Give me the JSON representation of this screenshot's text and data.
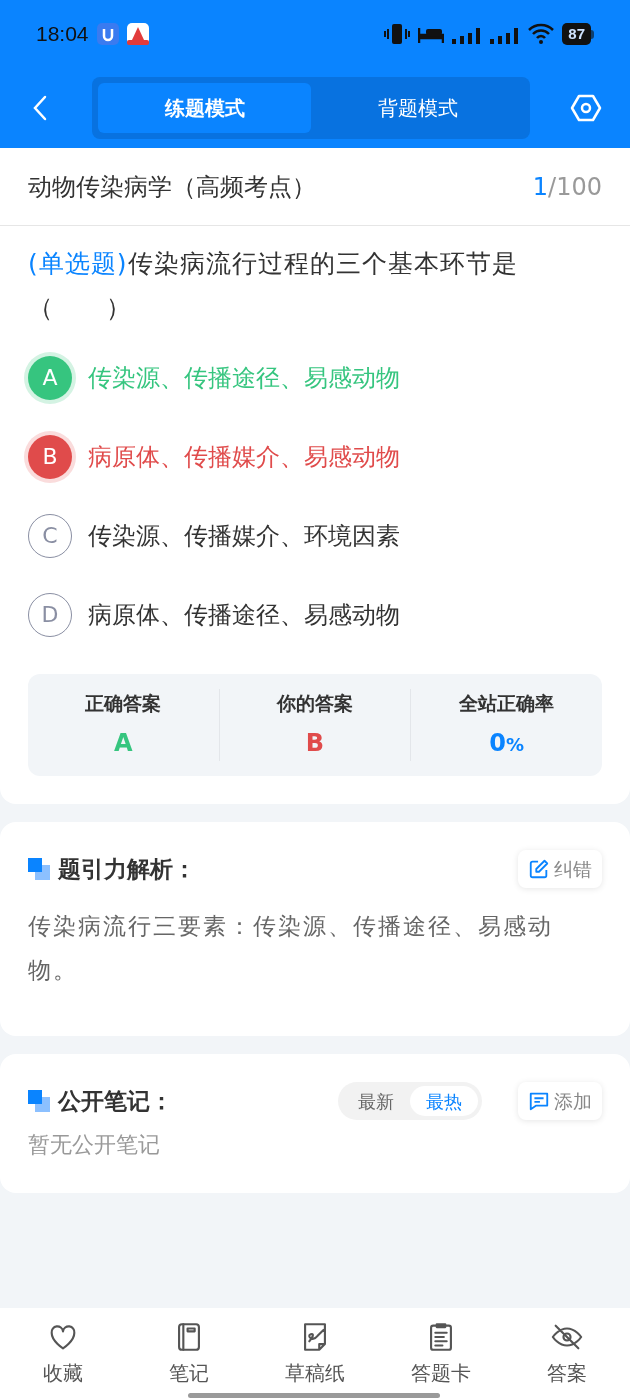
{
  "status_bar": {
    "time": "18:04",
    "battery": "87"
  },
  "header": {
    "tabs": [
      {
        "label": "练题模式",
        "selected": true
      },
      {
        "label": "背题模式",
        "selected": false
      }
    ]
  },
  "title_row": {
    "title": "动物传染病学（高频考点）",
    "current": "1",
    "total": "/100"
  },
  "question": {
    "type_label": "(单选题)",
    "text": "传染病流行过程的三个基本环节是（　　）"
  },
  "options": [
    {
      "letter": "A",
      "text": "传染源、传播途径、易感动物",
      "kind": "correct"
    },
    {
      "letter": "B",
      "text": "病原体、传播媒介、易感动物",
      "kind": "wrong"
    },
    {
      "letter": "C",
      "text": "传染源、传播媒介、环境因素",
      "kind": "normal"
    },
    {
      "letter": "D",
      "text": "病原体、传播途径、易感动物",
      "kind": "normal"
    }
  ],
  "stats": {
    "correct_label": "正确答案",
    "correct_value": "A",
    "yours_label": "你的答案",
    "yours_value": "B",
    "rate_label": "全站正确率",
    "rate_value": "0",
    "rate_unit": "%"
  },
  "analysis": {
    "title": "题引力解析：",
    "report_button": "纠错",
    "text": "传染病流行三要素：传染源、传播途径、易感动物。"
  },
  "notes": {
    "title": "公开笔记：",
    "sort": [
      {
        "label": "最新",
        "selected": false
      },
      {
        "label": "最热",
        "selected": true
      }
    ],
    "add_button": "添加",
    "empty": "暂无公开笔记"
  },
  "bottom_nav": [
    {
      "label": "收藏",
      "kind": "heart"
    },
    {
      "label": "笔记",
      "kind": "notebook"
    },
    {
      "label": "草稿纸",
      "kind": "draft"
    },
    {
      "label": "答题卡",
      "kind": "clipboard"
    },
    {
      "label": "答案",
      "kind": "eye"
    }
  ]
}
